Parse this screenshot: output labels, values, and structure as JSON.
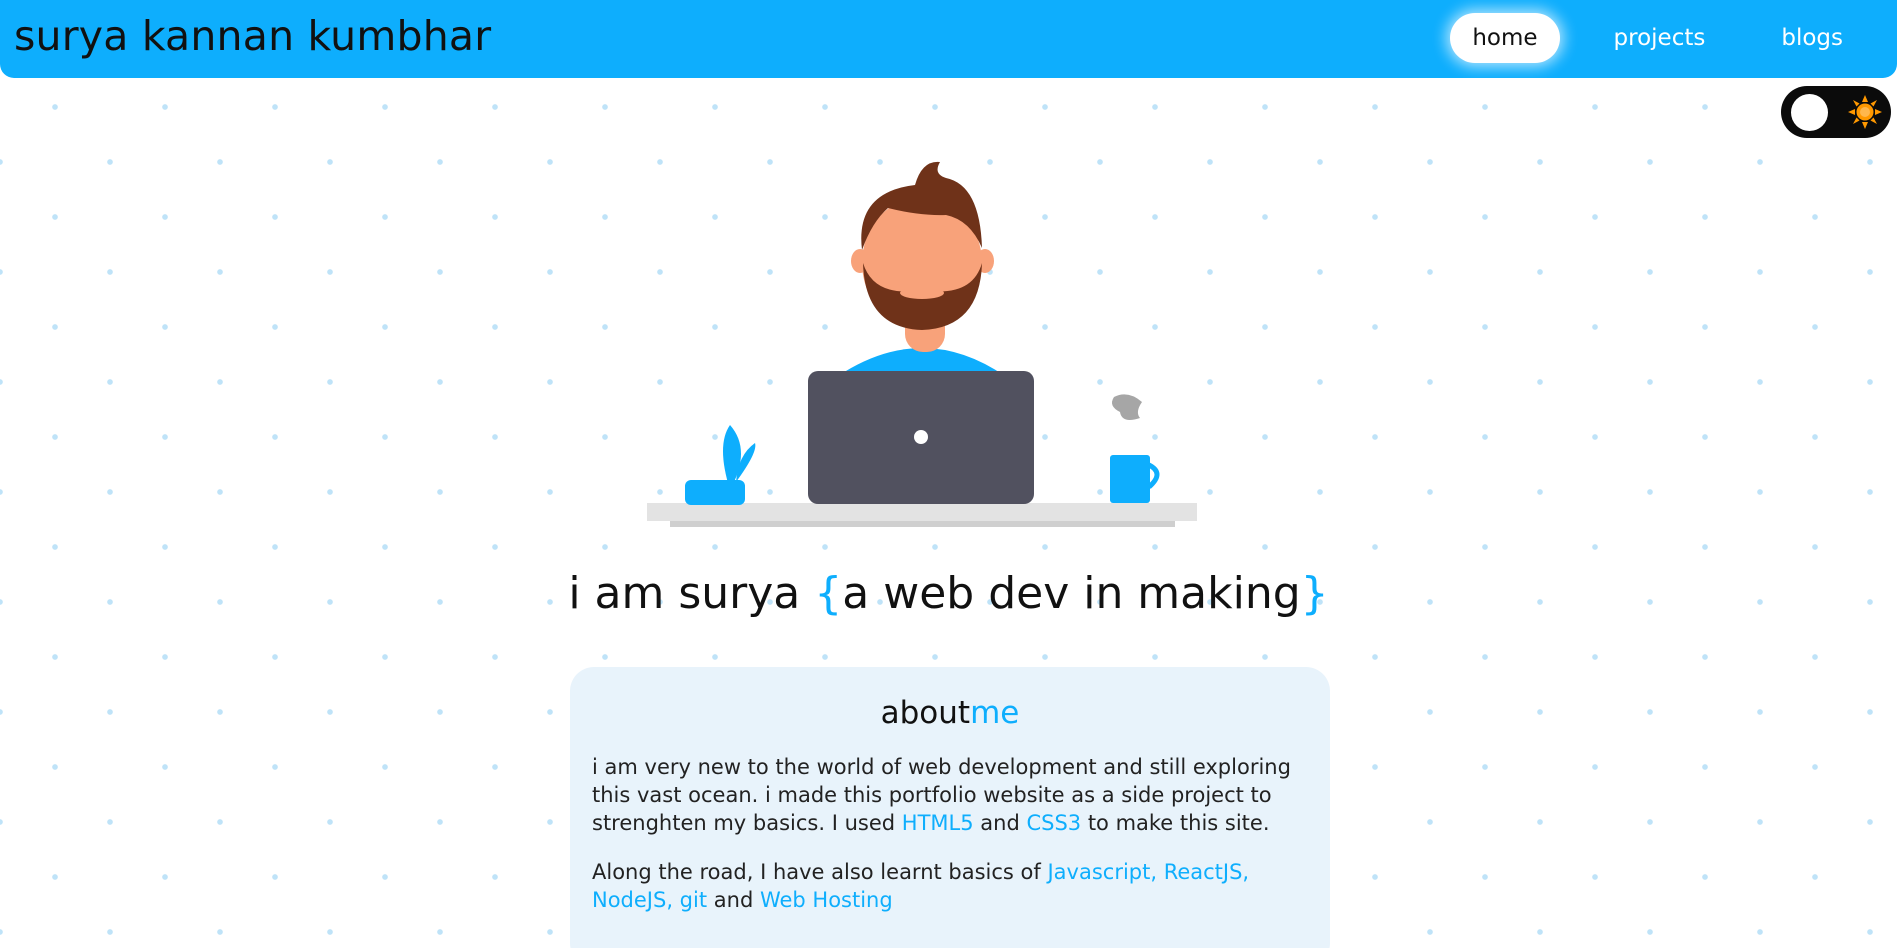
{
  "nav": {
    "brand": "surya kannan kumbhar",
    "links": [
      {
        "label": "home",
        "active": true
      },
      {
        "label": "projects",
        "active": false
      },
      {
        "label": "blogs",
        "active": false
      }
    ]
  },
  "theme_toggle": {
    "icon": "sun-icon",
    "mode": "light"
  },
  "hero": {
    "illustration": "developer-at-laptop-illustration",
    "headline_prefix": "i am surya ",
    "brace_open": "{",
    "headline_inner": "a web dev in making",
    "brace_close": "}"
  },
  "about": {
    "title_main": "about",
    "title_accent": "me",
    "p1_text_a": "i am very new to the world of web development and still exploring this vast ocean. i made this portfolio website as a side project to strenghten my basics. I used ",
    "p1_link_html": "HTML5",
    "p1_text_b": " and ",
    "p1_link_css": "CSS3",
    "p1_text_c": " to make this site.",
    "p2_text_a": "Along the road, I have also learnt basics of ",
    "p2_link_stack": "Javascript, ReactJS, NodeJS, git",
    "p2_text_b": " and ",
    "p2_link_hosting": "Web Hosting"
  },
  "colors": {
    "accent": "#0eaefd",
    "card_bg": "#e8f3fb",
    "dots": "#bfe3f8",
    "sun": "#ff9800"
  }
}
